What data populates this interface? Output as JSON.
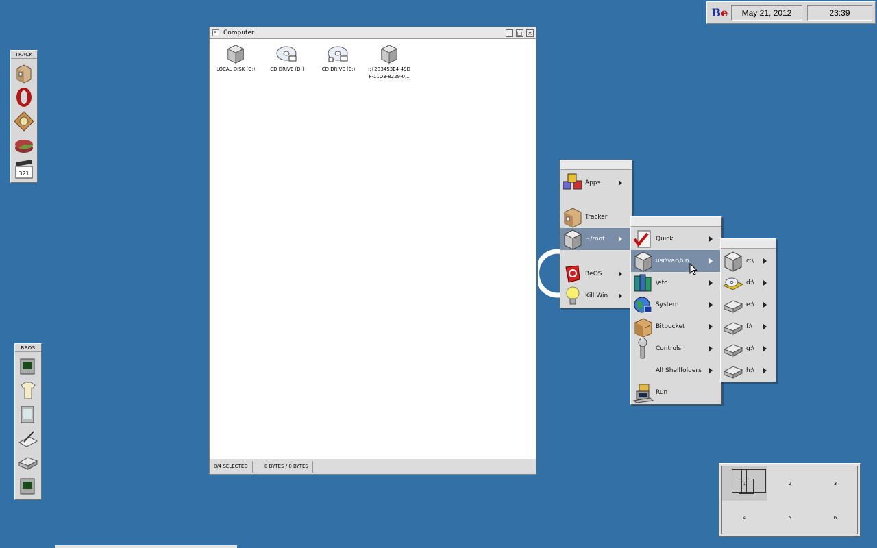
{
  "deskbar": {
    "logo_b": "B",
    "logo_e": "e",
    "date": "May 21, 2012",
    "time": "23:39"
  },
  "track_dock": {
    "title": "TRACK",
    "icons": [
      "tracker-icon",
      "opera-icon",
      "settings-icon",
      "disk-pie-icon",
      "clapper-icon"
    ]
  },
  "beos_dock": {
    "title": "BEOS",
    "icons": [
      "terminal-icon",
      "tshirt-icon",
      "screen-icon",
      "drawing-icon",
      "drive-icon",
      "monitor-icon"
    ]
  },
  "window": {
    "title": "Computer",
    "drives": [
      {
        "label": "LOCAL DISK (C:)",
        "icon": "hard-disk-icon"
      },
      {
        "label": "CD DRIVE (D:)",
        "icon": "cd-drive-icon"
      },
      {
        "label": "CD DRIVE (E:)",
        "icon": "cd-drive-icon"
      },
      {
        "label": "::{2B3453E4-49D",
        "label2": "F-11D3-8229-0...",
        "icon": "hard-disk-icon"
      }
    ],
    "status_selected": "0/4 SELECTED",
    "status_bytes": "0 BYTES / 0 BYTES"
  },
  "menu1": {
    "items": [
      {
        "label": "Apps",
        "icon": "apps-icon"
      },
      {
        "label": "Tracker",
        "icon": "tracker-icon"
      },
      {
        "label": "~/root",
        "icon": "root-disk-icon"
      },
      {
        "label": "BeOS",
        "icon": "beos-icon"
      },
      {
        "label": "Kill Win",
        "icon": "lightbulb-icon"
      }
    ]
  },
  "menu2": {
    "items": [
      {
        "label": "Quick",
        "icon": "checklist-icon"
      },
      {
        "label": "usr\\var\\bin",
        "icon": "disk-icon"
      },
      {
        "label": "\\etc",
        "icon": "books-icon"
      },
      {
        "label": "System",
        "icon": "globe-icon"
      },
      {
        "label": "Bitbucket",
        "icon": "bitbucket-icon"
      },
      {
        "label": "Controls",
        "icon": "wrench-icon"
      },
      {
        "label": "All Shellfolders",
        "icon": ""
      },
      {
        "label": "Run",
        "icon": "run-icon"
      }
    ]
  },
  "menu3": {
    "items": [
      {
        "label": "c:\\",
        "icon": "disk-icon"
      },
      {
        "label": "d:\\",
        "icon": "cd-icon"
      },
      {
        "label": "e:\\",
        "icon": "drive-icon"
      },
      {
        "label": "f:\\",
        "icon": "drive-icon"
      },
      {
        "label": "g:\\",
        "icon": "drive-icon"
      },
      {
        "label": "h:\\",
        "icon": "drive-icon"
      }
    ]
  },
  "workspaces": {
    "labels": [
      "1",
      "2",
      "3",
      "4",
      "5",
      "6"
    ],
    "current": 1
  },
  "colors": {
    "desktop": "#3370a5",
    "menu_selected": "#7a8fa7"
  }
}
